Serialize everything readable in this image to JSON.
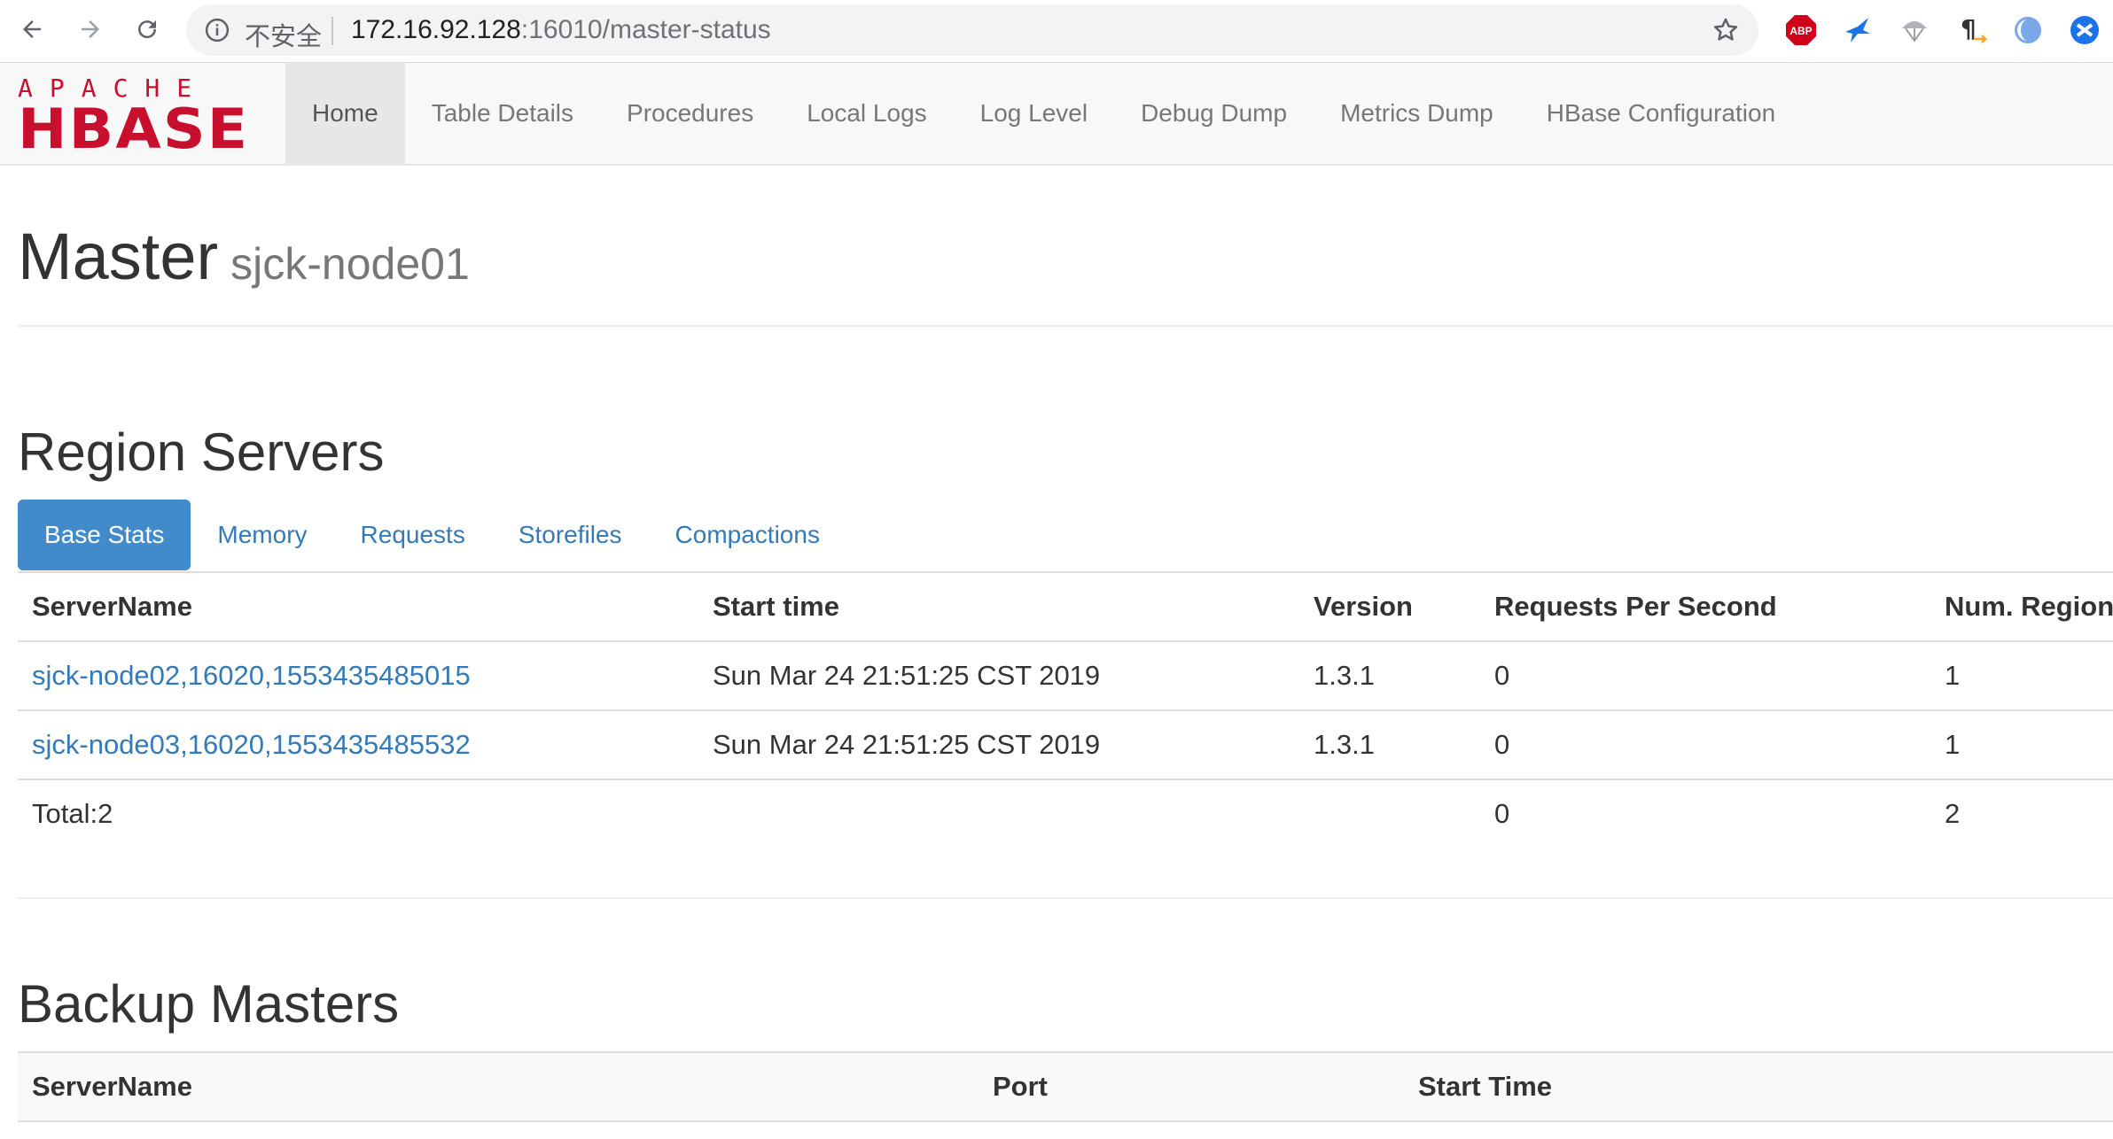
{
  "browser": {
    "insecure_label": "不安全",
    "url_host": "172.16.92.128",
    "url_rest": ":16010/master-status"
  },
  "nav": {
    "logo_top": "APACHE",
    "logo_main": "HBASE",
    "items": [
      {
        "label": "Home",
        "active": true
      },
      {
        "label": "Table Details"
      },
      {
        "label": "Procedures"
      },
      {
        "label": "Local Logs"
      },
      {
        "label": "Log Level"
      },
      {
        "label": "Debug Dump"
      },
      {
        "label": "Metrics Dump"
      },
      {
        "label": "HBase Configuration"
      }
    ]
  },
  "master": {
    "title": "Master",
    "host": "sjck-node01"
  },
  "region_servers": {
    "heading": "Region Servers",
    "tabs": [
      "Base Stats",
      "Memory",
      "Requests",
      "Storefiles",
      "Compactions"
    ],
    "columns": [
      "ServerName",
      "Start time",
      "Version",
      "Requests Per Second",
      "Num. Regions"
    ],
    "rows": [
      {
        "server": "sjck-node02,16020,1553435485015",
        "start": "Sun Mar 24 21:51:25 CST 2019",
        "version": "1.3.1",
        "rps": "0",
        "regions": "1"
      },
      {
        "server": "sjck-node03,16020,1553435485532",
        "start": "Sun Mar 24 21:51:25 CST 2019",
        "version": "1.3.1",
        "rps": "0",
        "regions": "1"
      }
    ],
    "total": {
      "label": "Total:2",
      "rps": "0",
      "regions": "2"
    }
  },
  "backup_masters": {
    "heading": "Backup Masters",
    "columns": [
      "ServerName",
      "Port",
      "Start Time"
    ]
  },
  "colors": {
    "accent": "#428bca",
    "link": "#337ab7",
    "logo": "#c8102e"
  }
}
